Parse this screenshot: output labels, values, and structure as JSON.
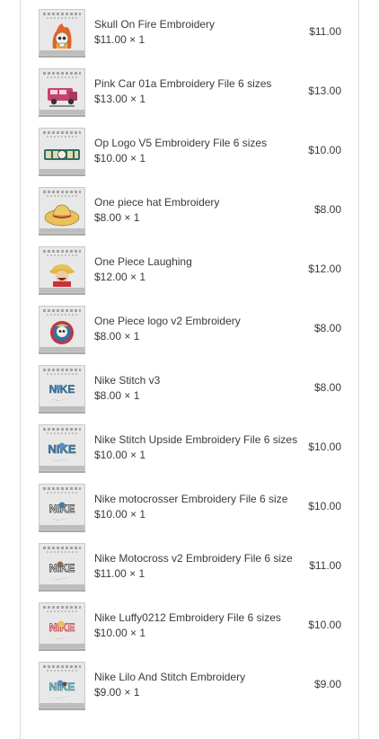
{
  "items": [
    {
      "name": "Skull On Fire Embroidery",
      "qty": "$11.00 × 1",
      "total": "$11.00",
      "icon": "skull-fire-icon"
    },
    {
      "name": "Pink Car 01a Embroidery File 6 sizes",
      "qty": "$13.00 × 1",
      "total": "$13.00",
      "icon": "pink-car-icon"
    },
    {
      "name": "Op Logo V5 Embroidery File 6 sizes",
      "qty": "$10.00 × 1",
      "total": "$10.00",
      "icon": "one-piece-logo-icon"
    },
    {
      "name": "One piece hat Embroidery",
      "qty": "$8.00 × 1",
      "total": "$8.00",
      "icon": "straw-hat-icon"
    },
    {
      "name": "One Piece Laughing",
      "qty": "$12.00 × 1",
      "total": "$12.00",
      "icon": "laughing-character-icon"
    },
    {
      "name": "One Piece logo v2 Embroidery",
      "qty": "$8.00 × 1",
      "total": "$8.00",
      "icon": "jolly-roger-icon"
    },
    {
      "name": "Nike Stitch v3",
      "qty": "$8.00 × 1",
      "total": "$8.00",
      "icon": "nike-stitch-icon"
    },
    {
      "name": "Nike Stitch Upside Embroidery File 6 sizes",
      "qty": "$10.00 × 1",
      "total": "$10.00",
      "icon": "nike-stitch-upside-icon"
    },
    {
      "name": "Nike motocrosser Embroidery File 6 size",
      "qty": "$10.00 × 1",
      "total": "$10.00",
      "icon": "nike-motocross-icon"
    },
    {
      "name": "Nike Motocross v2 Embroidery File 6 size",
      "qty": "$11.00 × 1",
      "total": "$11.00",
      "icon": "nike-motocross-v2-icon"
    },
    {
      "name": "Nike Luffy0212 Embroidery File 6 sizes",
      "qty": "$10.00 × 1",
      "total": "$10.00",
      "icon": "nike-luffy-icon"
    },
    {
      "name": "Nike Lilo And Stitch Embroidery",
      "qty": "$9.00 × 1",
      "total": "$9.00",
      "icon": "nike-lilo-stitch-icon"
    }
  ],
  "colors": {
    "text": "#3a3a3a",
    "border": "#dcdcdc",
    "thumb_bg": "#e8e8e8",
    "nike_blue": "#3d7fa6",
    "nike_red": "#c8323a"
  }
}
